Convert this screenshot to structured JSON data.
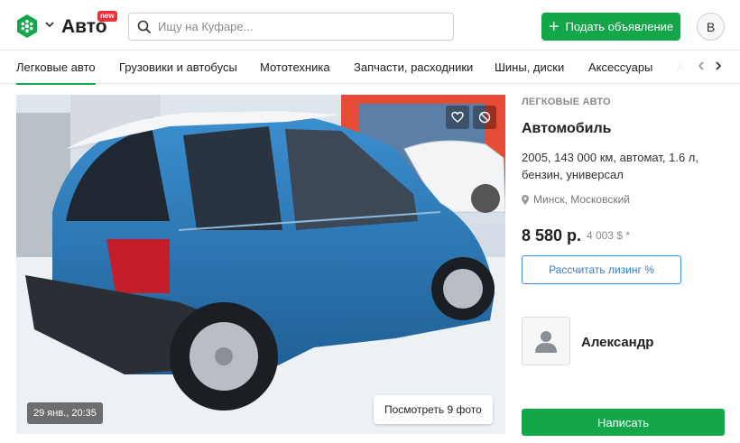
{
  "header": {
    "brand": "Авто",
    "badge": "new",
    "search_placeholder": "Ищу на Куфаре...",
    "post_label": "Подать объявление",
    "user_initial": "B",
    "accent_color": "#14a74a"
  },
  "categories": {
    "items": [
      {
        "label": "Легковые авто",
        "active": true
      },
      {
        "label": "Грузовики и автобусы"
      },
      {
        "label": "Мототехника"
      },
      {
        "label": "Запчасти, расходники"
      },
      {
        "label": "Шины, диски"
      },
      {
        "label": "Аксессуары"
      }
    ],
    "cut_label": "Ав"
  },
  "photo": {
    "date": "29 янв., 20:35",
    "more_label": "Посмотреть 9 фото",
    "icons": [
      "heart-icon",
      "block-icon"
    ]
  },
  "listing": {
    "category": "ЛЕГКОВЫЕ АВТО",
    "title": "Автомобиль",
    "specs": "2005, 143 000 км, автомат, 1.6 л, бензин, универсал",
    "location": "Минск, Московский",
    "price": "8 580 р.",
    "price_usd": "4 003 $ *",
    "leasing_label": "Рассчитать лизинг %",
    "leasing_color": "#3a8be3"
  },
  "seller": {
    "name": "Александр",
    "write_label": "Написать"
  }
}
